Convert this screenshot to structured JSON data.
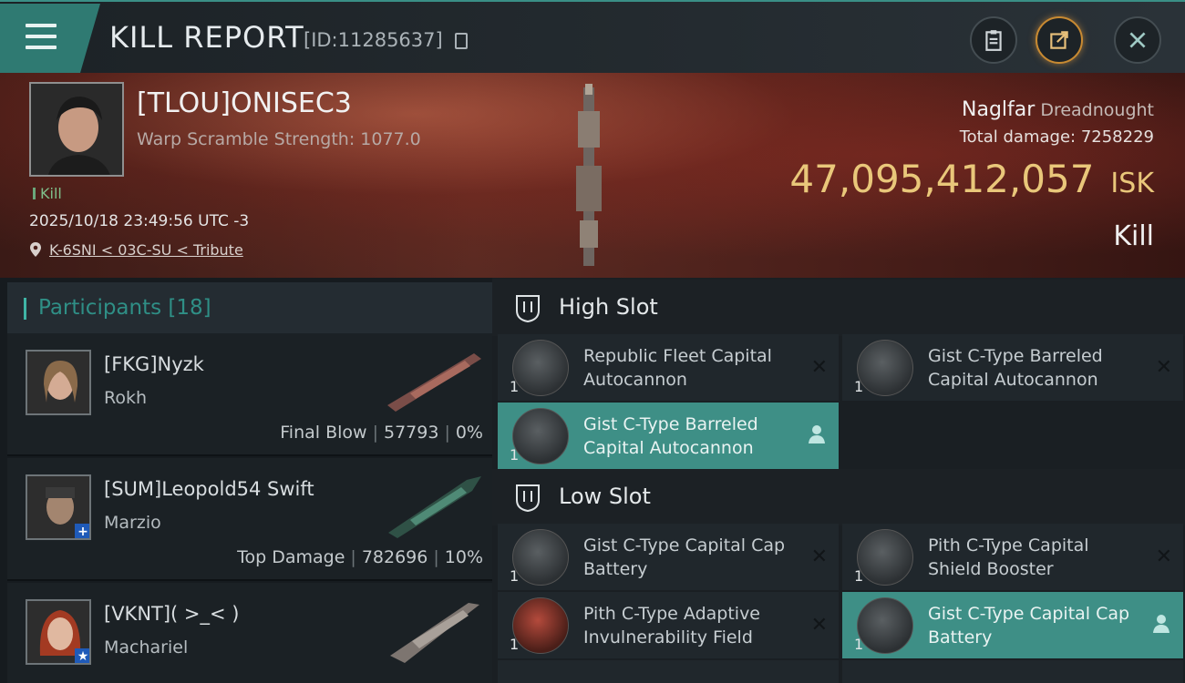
{
  "header": {
    "title": "KILL REPORT",
    "kill_id": "[ID:11285637]"
  },
  "victim": {
    "name": "[TLOU]ONISEC3",
    "scramble": "Warp Scramble Strength: 1077.0",
    "tag": "Kill",
    "datetime": "2025/10/18 23:49:56 UTC -3",
    "location": "K-6SNI < 03C-SU < Tribute",
    "ship": "Naglfar",
    "ship_class": "Dreadnought",
    "total_damage_label": "Total damage:",
    "total_damage": "7258229",
    "isk_value": "47,095,412,057",
    "isk_unit": "ISK",
    "outcome": "Kill"
  },
  "participants": {
    "label": "Participants",
    "count": "[18]",
    "rows": [
      {
        "name": "[FKG]Nyzk",
        "ship": "Rokh",
        "role": "Final Blow",
        "damage": "57793",
        "percent": "0%"
      },
      {
        "name": "[SUM]Leopold54 Swift",
        "ship": "Marzio",
        "role": "Top Damage",
        "damage": "782696",
        "percent": "10%"
      },
      {
        "name": "[VKNT]( >_< )",
        "ship": "Machariel"
      }
    ]
  },
  "fitting": {
    "high_slot_label": "High Slot",
    "low_slot_label": "Low Slot",
    "high": [
      {
        "name": "Republic Fleet Capital Autocannon",
        "qty": "1"
      },
      {
        "name": "Gist C-Type Barreled Capital Autocannon",
        "qty": "1"
      },
      {
        "name": "Gist C-Type Barreled Capital Autocannon",
        "qty": "1"
      }
    ],
    "low": [
      {
        "name": "Gist C-Type Capital Cap Battery",
        "qty": "1"
      },
      {
        "name": "Pith C-Type Capital Shield Booster",
        "qty": "1"
      },
      {
        "name": "Pith C-Type Adaptive Invulnerability Field",
        "qty": "1"
      },
      {
        "name": "Gist C-Type Capital Cap Battery",
        "qty": "1"
      }
    ]
  },
  "colors": {
    "accent": "#3e8f86",
    "isk": "#e9c77a"
  }
}
